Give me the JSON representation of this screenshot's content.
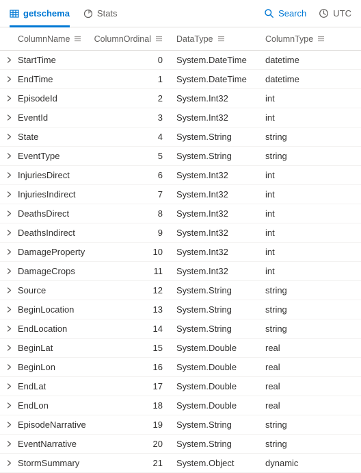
{
  "tabs": {
    "getschema": "getschema",
    "stats": "Stats"
  },
  "top_right": {
    "search": "Search",
    "tz": "UTC"
  },
  "columns": {
    "name": "ColumnName",
    "ordinal": "ColumnOrdinal",
    "dataType": "DataType",
    "columnType": "ColumnType"
  },
  "rows": [
    {
      "name": "StartTime",
      "ordinal": "0",
      "dataType": "System.DateTime",
      "columnType": "datetime"
    },
    {
      "name": "EndTime",
      "ordinal": "1",
      "dataType": "System.DateTime",
      "columnType": "datetime"
    },
    {
      "name": "EpisodeId",
      "ordinal": "2",
      "dataType": "System.Int32",
      "columnType": "int"
    },
    {
      "name": "EventId",
      "ordinal": "3",
      "dataType": "System.Int32",
      "columnType": "int"
    },
    {
      "name": "State",
      "ordinal": "4",
      "dataType": "System.String",
      "columnType": "string"
    },
    {
      "name": "EventType",
      "ordinal": "5",
      "dataType": "System.String",
      "columnType": "string"
    },
    {
      "name": "InjuriesDirect",
      "ordinal": "6",
      "dataType": "System.Int32",
      "columnType": "int"
    },
    {
      "name": "InjuriesIndirect",
      "ordinal": "7",
      "dataType": "System.Int32",
      "columnType": "int"
    },
    {
      "name": "DeathsDirect",
      "ordinal": "8",
      "dataType": "System.Int32",
      "columnType": "int"
    },
    {
      "name": "DeathsIndirect",
      "ordinal": "9",
      "dataType": "System.Int32",
      "columnType": "int"
    },
    {
      "name": "DamageProperty",
      "ordinal": "10",
      "dataType": "System.Int32",
      "columnType": "int"
    },
    {
      "name": "DamageCrops",
      "ordinal": "11",
      "dataType": "System.Int32",
      "columnType": "int"
    },
    {
      "name": "Source",
      "ordinal": "12",
      "dataType": "System.String",
      "columnType": "string"
    },
    {
      "name": "BeginLocation",
      "ordinal": "13",
      "dataType": "System.String",
      "columnType": "string"
    },
    {
      "name": "EndLocation",
      "ordinal": "14",
      "dataType": "System.String",
      "columnType": "string"
    },
    {
      "name": "BeginLat",
      "ordinal": "15",
      "dataType": "System.Double",
      "columnType": "real"
    },
    {
      "name": "BeginLon",
      "ordinal": "16",
      "dataType": "System.Double",
      "columnType": "real"
    },
    {
      "name": "EndLat",
      "ordinal": "17",
      "dataType": "System.Double",
      "columnType": "real"
    },
    {
      "name": "EndLon",
      "ordinal": "18",
      "dataType": "System.Double",
      "columnType": "real"
    },
    {
      "name": "EpisodeNarrative",
      "ordinal": "19",
      "dataType": "System.String",
      "columnType": "string"
    },
    {
      "name": "EventNarrative",
      "ordinal": "20",
      "dataType": "System.String",
      "columnType": "string"
    },
    {
      "name": "StormSummary",
      "ordinal": "21",
      "dataType": "System.Object",
      "columnType": "dynamic"
    }
  ]
}
